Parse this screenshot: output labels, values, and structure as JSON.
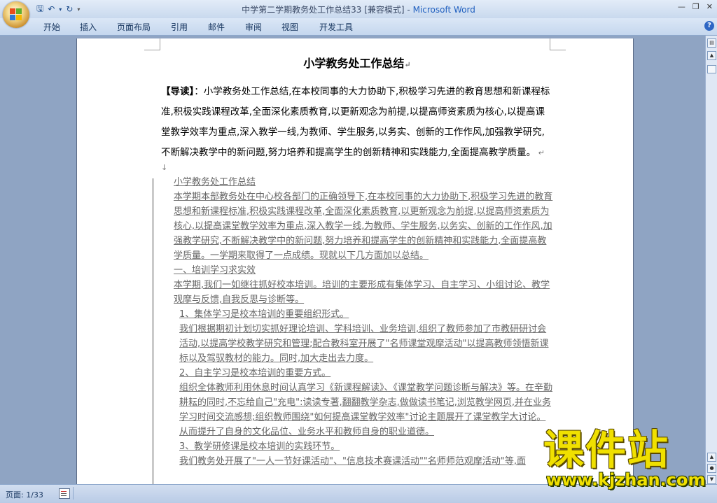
{
  "window": {
    "title_doc": "中学第二学期教务处工作总结33 [兼容模式] - ",
    "title_app": "Microsoft Word",
    "min": "—",
    "max": "❐",
    "close": "✕"
  },
  "ribbon": {
    "tabs": [
      "开始",
      "插入",
      "页面布局",
      "引用",
      "邮件",
      "审阅",
      "视图",
      "开发工具"
    ],
    "help": "?"
  },
  "document": {
    "title": "小学教务处工作总结",
    "intro_label": "【导读】",
    "intro_text": "：小学教务处工作总结,在本校同事的大力协助下,积极学习先进的教育思想和新课程标准,积极实践课程改革,全面深化素质教育,以更新观念为前提,以提高师资素质为核心,以提高课堂教学效率为重点,深入教学一线,为教师、学生服务,以务实、创新的工作作风,加强教学研究,不断解决教学中的新问题,努力培养和提高学生的创新精神和实践能力,全面提高教学质量。",
    "paragraphs": [
      {
        "text": "小学教务处工作总结",
        "indent": "ind2"
      },
      {
        "text": "本学期本部教务处在中心校各部门的正确领导下,在本校同事的大力协助下,积极学习先进的教育思想和新课程标准,积极实践课程改革,全面深化素质教育,以更新观念为前提,以提高师资素质为核心,以提高课堂教学效率为重点,深入教学一线,为教师、学生服务,以务实、创新的工作作风,加强教学研究,不断解决教学中的新问题,努力培养和提高学生的创新精神和实践能力,全面提高教学质量。一学期来取得了一点成绩。现就以下几方面加以总结。",
        "indent": "ind2"
      },
      {
        "text": "一、培训学习求实效",
        "indent": "ind2"
      },
      {
        "text": "本学期,我们一如继往抓好校本培训。培训的主要形成有集体学习、自主学习、小组讨论、教学观摩与反馈,自我反思与诊断等。",
        "indent": "ind2"
      },
      {
        "text": "1、集体学习是校本培训的重要组织形式。",
        "indent": "ind"
      },
      {
        "text": "我们根据期初计划切实抓好理论培训、学科培训、业务培训,组织了教师参加了市教研研讨会活动,以提高学校教学研究和管理;配合教科室开展了\"名师课堂观摩活动\"以提高教师领悟新课标以及驾驭教材的能力。同时,加大走出去力度。",
        "indent": "ind"
      },
      {
        "text": "2、自主学习是校本培训的重要方式。",
        "indent": "ind"
      },
      {
        "text": "组织全体教师利用休息时间认真学习《新课程解读》、《课堂教学问题诊断与解决》等。在辛勤耕耘的同时,不忘给自己\"充电\":读读专著,翻翻教学杂志,做做读书笔记,浏览教学网页,并在业务学习时间交流感想;组织教师围绕\"如何提高课堂教学效率\"讨论主题展开了课堂教学大讨论。从而提升了自身的文化品位、业务水平和教师自身的职业道德。",
        "indent": "ind"
      },
      {
        "text": "3、教学研修课是校本培训的实践环节。",
        "indent": "ind"
      },
      {
        "text": "我们教务处开展了\"一人一节好课活动\"、\"信息技术赛课活动\"\"名师师范观摩活动\"等,面",
        "indent": "ind"
      }
    ]
  },
  "status": {
    "page": "页面: 1/33"
  },
  "watermark": {
    "main": "课件站",
    "url": "www.kjzhan.com"
  },
  "colors": {
    "accent": "#1f5fbf",
    "workspace": "#8fa4c3",
    "watermark": "#f0e000"
  }
}
